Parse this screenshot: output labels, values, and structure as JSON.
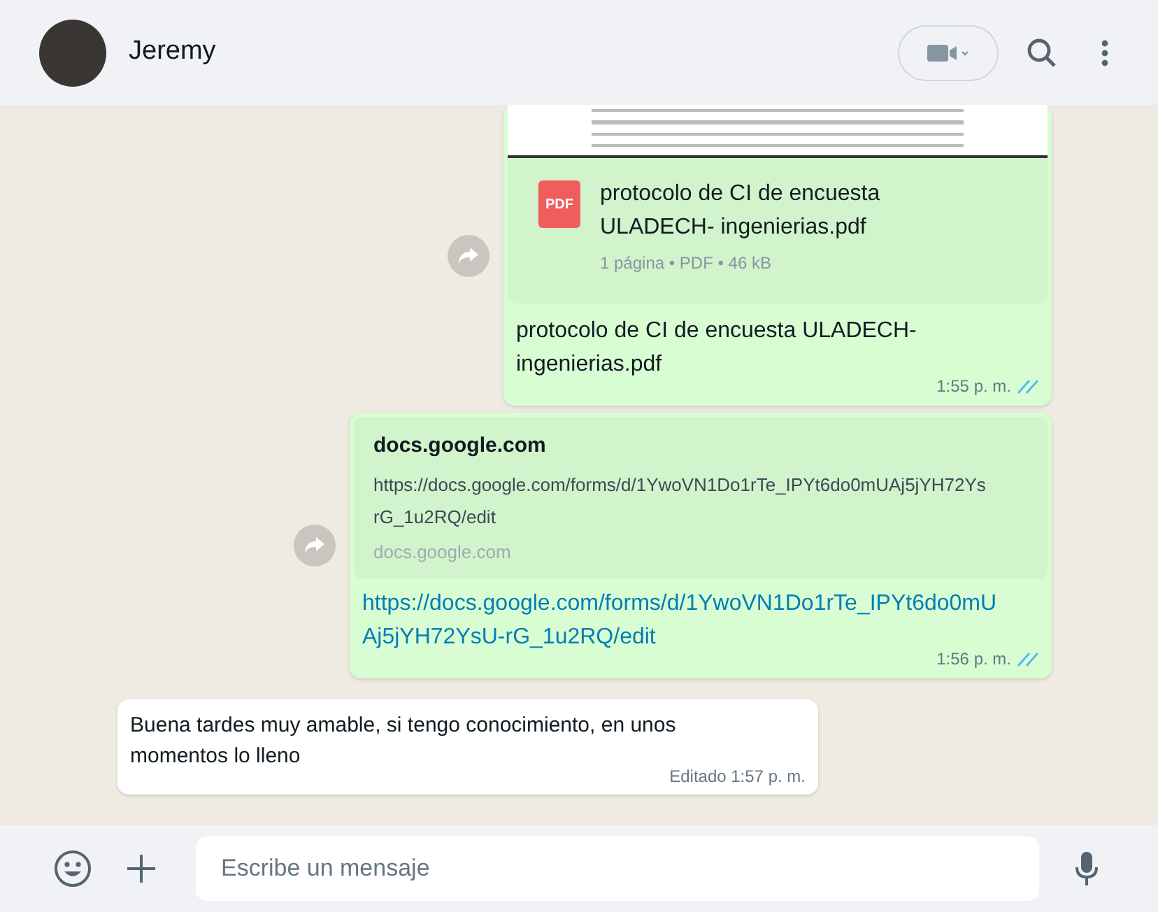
{
  "header": {
    "contact_name": "Jeremy"
  },
  "messages": [
    {
      "kind": "document",
      "outgoing": true,
      "forwardable": true,
      "file_name": "protocolo de CI de encuesta ULADECH- ingenierias.pdf",
      "file_type_badge": "PDF",
      "file_meta": "1 página • PDF • 46 kB",
      "caption": "protocolo de CI de encuesta ULADECH- ingenierias.pdf",
      "time": "1:55 p. m.",
      "read": true
    },
    {
      "kind": "link",
      "outgoing": true,
      "forwardable": true,
      "preview_title": "docs.google.com",
      "preview_description": "https://docs.google.com/forms/d/1YwoVN1Do1rTe_IPYt6do0mUAj5jYH72Ys rG_1u2RQ/edit",
      "preview_domain": "docs.google.com",
      "url": "https://docs.google.com/forms/d/1YwoVN1Do1rTe_IPYt6do0mUAj5jYH72YsU-rG_1u2RQ/edit",
      "time": "1:56 p. m.",
      "read": true
    },
    {
      "kind": "text",
      "outgoing": false,
      "forwardable": false,
      "text": "Buena tardes muy amable, si tengo conocimiento, en unos momentos lo lleno",
      "time": "Editado 1:57 p. m."
    }
  ],
  "composer": {
    "placeholder": "Escribe un mensaje"
  }
}
